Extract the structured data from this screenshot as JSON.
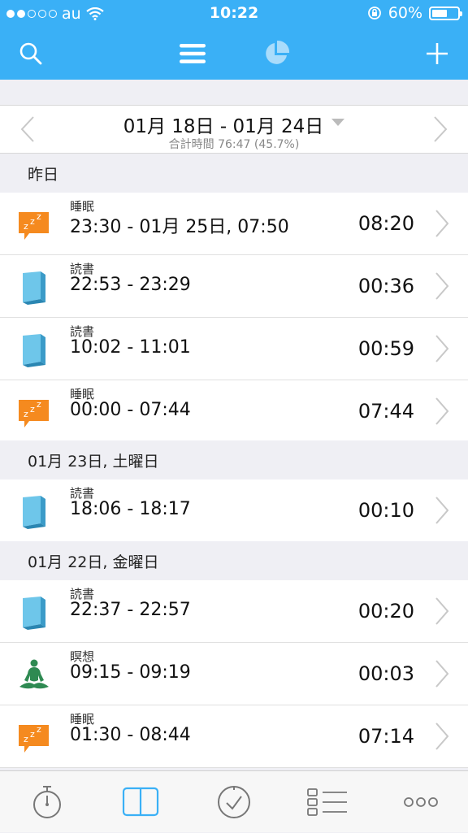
{
  "status": {
    "carrier": "au",
    "time": "10:22",
    "battery": "60%",
    "battery_level": 0.6
  },
  "navbar": {
    "icons": [
      "search-icon",
      "menu-icon",
      "pie-chart-icon",
      "add-icon"
    ],
    "accent": "#3ab0f6"
  },
  "range": {
    "title": "01月 18日 - 01月 24日",
    "subtitle": "合計時間 76:47 (45.7%)"
  },
  "sections": [
    {
      "header": "昨日",
      "rows": [
        {
          "icon": "sleep-icon",
          "category": "睡眠",
          "range": "23:30 - 01月 25日, 07:50",
          "duration": "08:20"
        },
        {
          "icon": "book-icon",
          "category": "読書",
          "range": "22:53 - 23:29",
          "duration": "00:36"
        },
        {
          "icon": "book-icon",
          "category": "読書",
          "range": "10:02 - 11:01",
          "duration": "00:59"
        },
        {
          "icon": "sleep-icon",
          "category": "睡眠",
          "range": "00:00 - 07:44",
          "duration": "07:44"
        }
      ]
    },
    {
      "header": "01月 23日, 土曜日",
      "rows": [
        {
          "icon": "book-icon",
          "category": "読書",
          "range": "18:06 - 18:17",
          "duration": "00:10"
        }
      ]
    },
    {
      "header": "01月 22日, 金曜日",
      "rows": [
        {
          "icon": "book-icon",
          "category": "読書",
          "range": "22:37 - 22:57",
          "duration": "00:20"
        },
        {
          "icon": "meditation-icon",
          "category": "瞑想",
          "range": "09:15 - 09:19",
          "duration": "00:03"
        },
        {
          "icon": "sleep-icon",
          "category": "睡眠",
          "range": "01:30 - 08:44",
          "duration": "07:14"
        }
      ]
    }
  ],
  "tabbar": {
    "icons": [
      "stopwatch-icon",
      "log-book-icon",
      "goals-icon",
      "list-icon",
      "more-icon"
    ],
    "active_index": 1
  }
}
